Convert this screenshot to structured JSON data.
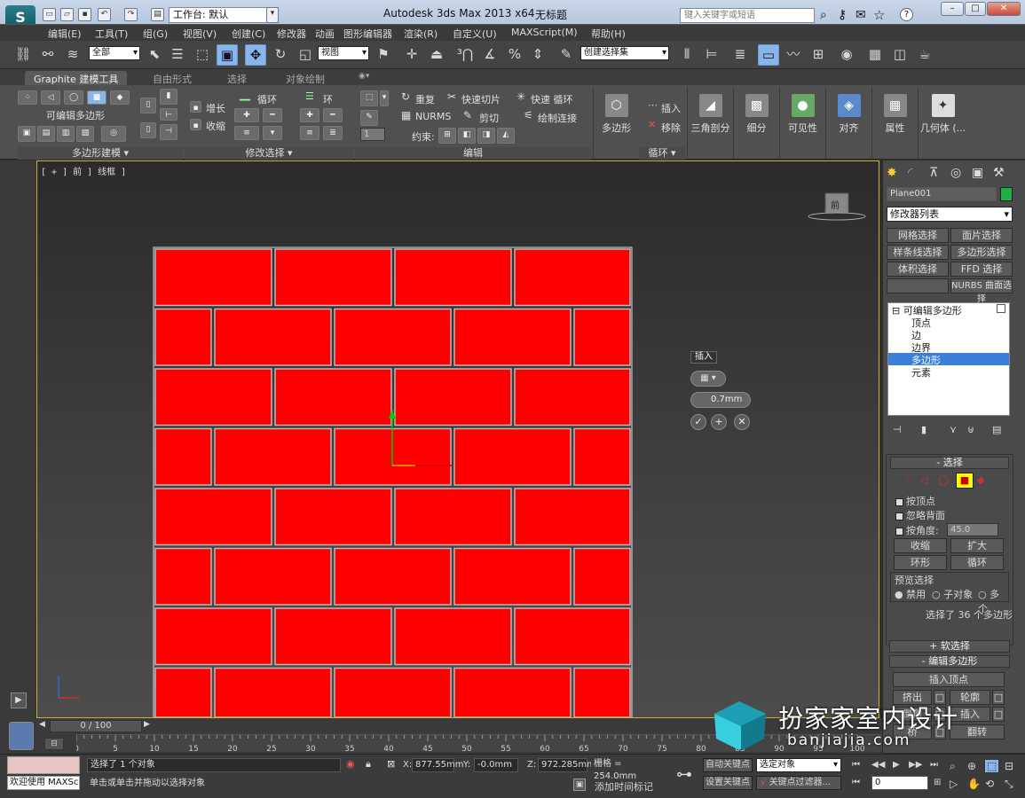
{
  "titlebar": {
    "workspace": "工作台: 默认",
    "title": "Autodesk 3ds Max  2013 x64",
    "doc": "无标题",
    "search_placeholder": "键入关键字或短语"
  },
  "menu": [
    "编辑(E)",
    "工具(T)",
    "组(G)",
    "视图(V)",
    "创建(C)",
    "修改器",
    "动画",
    "图形编辑器",
    "渲染(R)",
    "自定义(U)",
    "MAXScript(M)",
    "帮助(H)"
  ],
  "toolbar": {
    "filter": "全部",
    "refcoord": "视图",
    "named_sel": "创建选择集"
  },
  "ribbon": {
    "tabs": [
      "Graphite 建模工具",
      "自由形式",
      "选择",
      "对象绘制"
    ],
    "editable_poly": "可编辑多边形",
    "grow": "增长",
    "shrink": "收缩",
    "loop": "循环",
    "ring": "环",
    "repeat": "重复",
    "quickslice": "快速切片",
    "quickloop": "快速 循环",
    "nurms": "NURMS",
    "cut": "剪切",
    "paintconnect": "绘制连接",
    "constraint": "约束:",
    "spinval": "1",
    "insert": "插入",
    "remove": "移除",
    "groups": [
      "多边形建模",
      "修改选择",
      "编辑",
      "循环"
    ],
    "big": [
      "多边形",
      "三角剖分",
      "细分",
      "可见性",
      "对齐",
      "属性",
      "几何体 (..."
    ]
  },
  "viewport": {
    "label": "[ + ] 前 ] 线框 ]",
    "viewcube": "前",
    "caddy_title": "插入",
    "caddy_value": "0.7mm"
  },
  "panel": {
    "objname": "Plane001",
    "modlist": "修改器列表",
    "modbtns": [
      "网格选择",
      "面片选择",
      "样条线选择",
      "多边形选择",
      "体积选择",
      "FFD 选择",
      "NURBS 曲面选择"
    ],
    "stack": [
      "可编辑多边形",
      "顶点",
      "边",
      "边界",
      "多边形",
      "元素"
    ],
    "sel_head": "选择",
    "by_vertex": "按顶点",
    "ignore_back": "忽略背面",
    "by_angle": "按角度:",
    "angle_val": "45.0",
    "shrink": "收缩",
    "grow": "扩大",
    "ring": "环形",
    "loop": "循环",
    "preview": "预览选择",
    "disabled": "禁用",
    "subobj": "子对象",
    "multi": "多个",
    "sel_status": "选择了 36 个多边形",
    "soft_sel": "软选择",
    "edit_poly": "编辑多边形",
    "insert_vertex": "插入顶点",
    "extrude": "挤出",
    "outline": "轮廓",
    "bevel": "倒角",
    "inset": "插入",
    "bridge": "桥",
    "flip": "翻转"
  },
  "timeline": {
    "frame": "0 / 100",
    "ticks": [
      "0",
      "5",
      "10",
      "15",
      "20",
      "25",
      "30",
      "35",
      "40",
      "45",
      "50",
      "55",
      "60",
      "65",
      "70",
      "75",
      "80",
      "85",
      "90",
      "95",
      "100"
    ]
  },
  "status": {
    "welcome": "欢迎使用 MAXSc",
    "line1": "选择了 1 个对象",
    "line2": "单击或单击并拖动以选择对象",
    "x_label": "X:",
    "x": "877.55mm",
    "y_label": "Y:",
    "y": "-0.0mm",
    "z_label": "Z:",
    "z": "972.285mm",
    "grid": "栅格 = 254.0mm",
    "add_tag": "添加时间标记",
    "autokey": "自动关键点",
    "selobj": "选定对象",
    "setkey": "设置关键点",
    "keyfilter": "关键点过滤器...",
    "frame": "0"
  },
  "watermark": {
    "cn": "扮家家室内设计",
    "url": "banjiajia.com"
  },
  "colors": {
    "brick": "#ff0000",
    "mortar": "#b9b9b9",
    "highlight": "#4a8edc"
  }
}
